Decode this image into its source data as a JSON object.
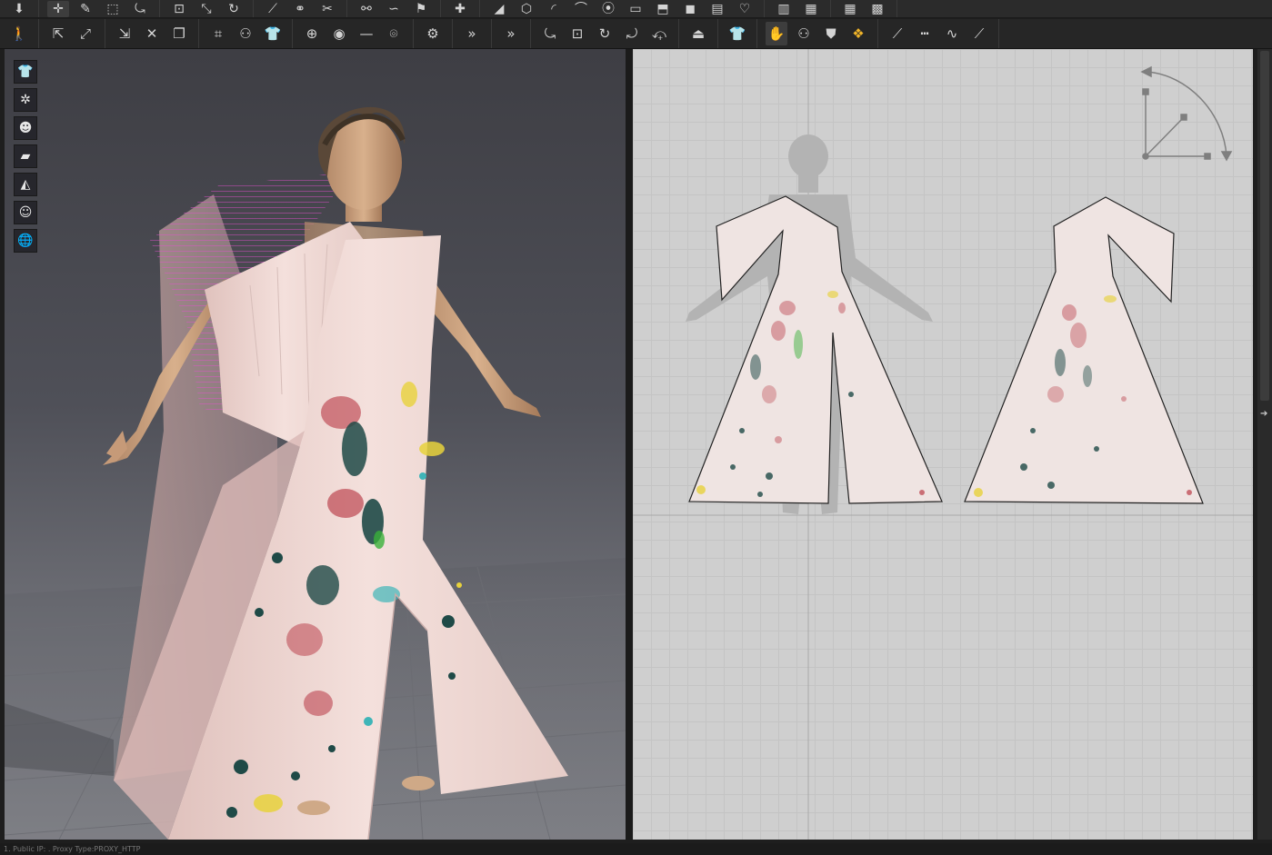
{
  "toolbar_top": {
    "groups": [
      [
        {
          "icon": "import-down-arrow-icon",
          "glyph": "⬇"
        }
      ],
      [
        {
          "icon": "transform-move-icon",
          "glyph": "✛",
          "active": true
        },
        {
          "icon": "edit-pattern-icon",
          "glyph": "✎"
        },
        {
          "icon": "select-box-icon",
          "glyph": "⬚"
        },
        {
          "icon": "edit-segment-icon",
          "glyph": "⤿"
        }
      ],
      [
        {
          "icon": "add-point-icon",
          "glyph": "⊡"
        },
        {
          "icon": "curve-point-icon",
          "glyph": "⤡"
        },
        {
          "icon": "rotate-pattern-icon",
          "glyph": "↻"
        }
      ],
      [
        {
          "icon": "pen-icon",
          "glyph": "⟋"
        },
        {
          "icon": "link-icon",
          "glyph": "⚭"
        },
        {
          "icon": "cut-icon",
          "glyph": "✂"
        }
      ],
      [
        {
          "icon": "sew-segment-icon",
          "glyph": "⚯"
        },
        {
          "icon": "sew-free-icon",
          "glyph": "∽"
        },
        {
          "icon": "check-sewing-icon",
          "glyph": "⚑"
        }
      ],
      [
        {
          "icon": "grid-plus-icon",
          "glyph": "✚"
        }
      ],
      [
        {
          "icon": "edit-line-icon",
          "glyph": "◢"
        },
        {
          "icon": "polygon-icon",
          "glyph": "⬡"
        },
        {
          "icon": "arc-icon",
          "glyph": "◜"
        },
        {
          "icon": "curve-icon",
          "glyph": "⌒"
        },
        {
          "icon": "point-icon",
          "glyph": "⦿"
        },
        {
          "icon": "rectangle-icon",
          "glyph": "▭"
        },
        {
          "icon": "rect-bend-icon",
          "glyph": "⬒"
        },
        {
          "icon": "square-fill-icon",
          "glyph": "◼"
        },
        {
          "icon": "page-icon",
          "glyph": "▤"
        },
        {
          "icon": "heart-icon",
          "glyph": "♡"
        }
      ],
      [
        {
          "icon": "bar-chart-icon",
          "glyph": "▥"
        },
        {
          "icon": "levels-icon",
          "glyph": "▦"
        }
      ],
      [
        {
          "icon": "grid-edit-icon",
          "glyph": "▦"
        },
        {
          "icon": "grid-skew-icon",
          "glyph": "▩"
        }
      ]
    ]
  },
  "toolbar_main": {
    "groups": [
      [
        {
          "icon": "walk-avatar-icon",
          "glyph": "🚶"
        }
      ],
      [
        {
          "icon": "select-pattern-icon",
          "glyph": "⇱"
        },
        {
          "icon": "fold-arrange-icon",
          "glyph": "⤢"
        }
      ],
      [
        {
          "icon": "tack-icon",
          "glyph": "⇲"
        },
        {
          "icon": "pin-icon",
          "glyph": "✕"
        },
        {
          "icon": "garment-piece-icon",
          "glyph": "❐"
        }
      ],
      [
        {
          "icon": "arrange-point-icon",
          "glyph": "⌗"
        },
        {
          "icon": "arrange-avatar-icon",
          "glyph": "⚇"
        },
        {
          "icon": "shirt-icon",
          "glyph": "👕"
        }
      ],
      [
        {
          "icon": "add-button-icon",
          "glyph": "⊕"
        },
        {
          "icon": "button-icon",
          "glyph": "◉"
        },
        {
          "icon": "line-icon",
          "glyph": "—"
        },
        {
          "icon": "buttonhole-icon",
          "glyph": "⌾"
        }
      ],
      [
        {
          "icon": "zipper-icon",
          "glyph": "⚙"
        }
      ],
      [
        {
          "icon": "more-icon",
          "glyph": "»"
        }
      ],
      [
        {
          "icon": "more-right-icon",
          "glyph": "»"
        }
      ],
      [
        {
          "icon": "edit-pattern-2d-icon",
          "glyph": "⤿"
        },
        {
          "icon": "add-point-2d-icon",
          "glyph": "⊡"
        },
        {
          "icon": "curve-2d-icon",
          "glyph": "↻"
        },
        {
          "icon": "seam-icon",
          "glyph": "⤾"
        },
        {
          "icon": "fold-icon",
          "glyph": "⤽"
        }
      ],
      [
        {
          "icon": "iron-icon",
          "glyph": "⏏"
        }
      ],
      [
        {
          "icon": "garment-icon",
          "glyph": "👕"
        }
      ],
      [
        {
          "icon": "texture-select-icon",
          "glyph": "✋",
          "active": true,
          "accent": true
        },
        {
          "icon": "avatar-fit-icon",
          "glyph": "⚇"
        },
        {
          "icon": "shirt-2d-icon",
          "glyph": "⛊"
        },
        {
          "icon": "grade-icon",
          "glyph": "❖",
          "accent": true
        }
      ],
      [
        {
          "icon": "draw-line-icon",
          "glyph": "⟋"
        },
        {
          "icon": "dashed-line-icon",
          "glyph": "┅"
        },
        {
          "icon": "wave-line-icon",
          "glyph": "∿"
        },
        {
          "icon": "slant-line-icon",
          "glyph": "⟋"
        }
      ]
    ]
  },
  "side_tools": [
    {
      "icon": "shirt-display-icon",
      "glyph": "👕"
    },
    {
      "icon": "particle-distance-icon",
      "glyph": "✲"
    },
    {
      "icon": "avatar-display-icon",
      "glyph": "☻"
    },
    {
      "icon": "texture-display-icon",
      "glyph": "▰"
    },
    {
      "icon": "mesh-display-icon",
      "glyph": "◭"
    },
    {
      "icon": "skin-display-icon",
      "glyph": "☺"
    },
    {
      "icon": "environment-globe-icon",
      "glyph": "🌐"
    }
  ],
  "colors": {
    "fabric": "#f2dcd8",
    "fabric_edge": "#e8cac4",
    "magenta_lines": "#e64fd0",
    "splatter_dark": "#1f4a47",
    "splatter_red": "#c0505a",
    "splatter_yellow": "#e8d23c",
    "splatter_teal": "#3fb5b8"
  },
  "status": {
    "text": "1. Public IP: . Proxy Type:PROXY_HTTP"
  }
}
